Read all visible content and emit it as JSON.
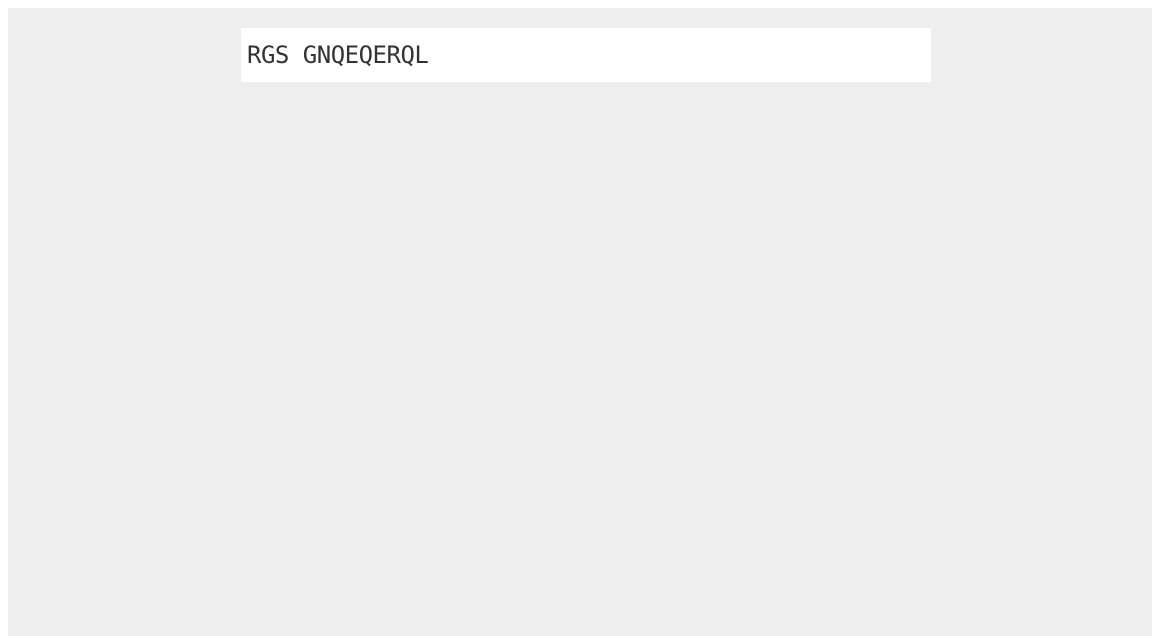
{
  "field": {
    "value": "RGS GNQEQERQL"
  },
  "colors": {
    "canvas_background": "#eeeeee",
    "field_background": "#ffffff",
    "text": "#333333"
  }
}
